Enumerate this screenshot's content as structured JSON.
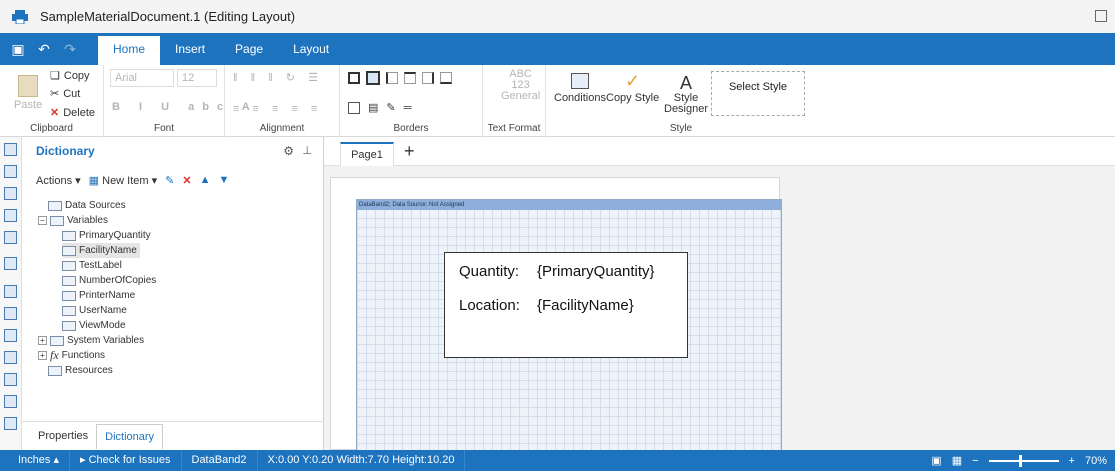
{
  "window": {
    "title": "SampleMaterialDocument.1 (Editing Layout)"
  },
  "ribbon_tabs": [
    "Home",
    "Insert",
    "Page",
    "Layout"
  ],
  "clipboard": {
    "paste": "Paste",
    "copy": "Copy",
    "cut": "Cut",
    "delete": "Delete",
    "label": "Clipboard"
  },
  "font": {
    "name": "Arial",
    "size": "12",
    "label": "Font"
  },
  "alignment": {
    "label": "Alignment"
  },
  "borders": {
    "label": "Borders"
  },
  "text_format": {
    "abc": "ABC",
    "num": "123",
    "general": "General",
    "label": "Text Format"
  },
  "style": {
    "conditions": "Conditions",
    "copy_style": "Copy Style",
    "style_designer_1": "Style",
    "style_designer_2": "Designer",
    "select_style": "Select Style",
    "label": "Style"
  },
  "dictionary": {
    "title": "Dictionary",
    "actions": "Actions",
    "new_item": "New Item",
    "tree": {
      "data_sources": "Data Sources",
      "variables": "Variables",
      "vars": [
        "PrimaryQuantity",
        "FacilityName",
        "TestLabel",
        "NumberOfCopies",
        "PrinterName",
        "UserName",
        "ViewMode"
      ],
      "system_variables": "System Variables",
      "functions": "Functions",
      "resources": "Resources"
    },
    "tabs": [
      "Properties",
      "Dictionary"
    ]
  },
  "page_tab": "Page1",
  "band_header": "DataBand2; Data Source: Not Assigned",
  "fields": {
    "quantity_label": "Quantity:",
    "quantity_value": "{PrimaryQuantity}",
    "location_label": "Location:",
    "location_value": "{FacilityName}"
  },
  "status": {
    "units": "Inches",
    "check": "Check for Issues",
    "component": "DataBand2",
    "geometry": "X:0.00 Y:0.20 Width:7.70 Height:10.20",
    "zoom": "70%"
  },
  "colors": {
    "accent": "#1e73be"
  }
}
